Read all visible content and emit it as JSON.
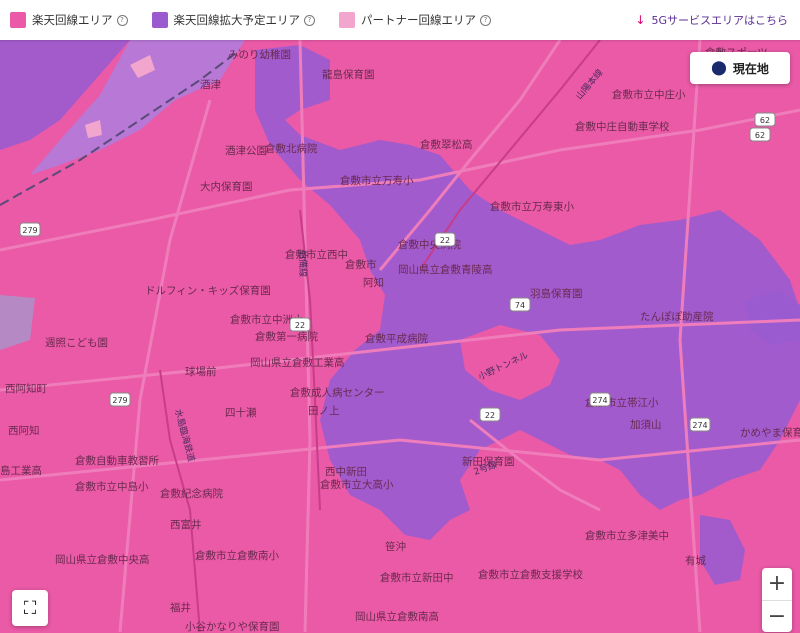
{
  "legend": {
    "items": [
      {
        "label": "楽天回線エリア",
        "color": "#ea5aa6"
      },
      {
        "label": "楽天回線拡大予定エリア",
        "color": "#9b5bd0"
      },
      {
        "label": "パートナー回線エリア",
        "color": "#f3a6cd"
      }
    ],
    "help_glyph": "?",
    "g5_link": "5Gサービスエリアはこちら"
  },
  "controls": {
    "current_location": "現在地",
    "zoom_in": "+",
    "zoom_out": "−",
    "fullscreen": "⛶"
  },
  "map": {
    "labels": [
      "みのり幼稚園",
      "龍島保育園",
      "倉敷スポーツ",
      "倉敷市立中庄小",
      "倉敷中庄自動車学校",
      "倉敷翠松高",
      "倉敷北病院",
      "酒津公園",
      "倉敷市立万寿小",
      "倉敷市立万寿東小",
      "大内保育園",
      "倉敷中央病院",
      "倉敷市立西中",
      "倉敷市",
      "岡山県立倉敷青陵高",
      "羽島保育園",
      "たんぽぽ助産院",
      "ドルフィン・キッズ保育園",
      "倉敷市立中洲小",
      "倉敷第一病院",
      "倉敷平成病院",
      "週照こども園",
      "岡山県立倉敷工業高",
      "倉敷成人病センター",
      "倉敷市立帯江小",
      "西阿知町",
      "西阿知",
      "四十瀬",
      "田ノ上",
      "かめやま保育",
      "倉敷自動車教習所",
      "新田保育園",
      "島工業高",
      "倉敷市立中島小",
      "倉敷紀念病院",
      "西中新田",
      "倉敷市立大高小",
      "西富井",
      "倉敷市立多津美中",
      "岡山県立倉敷中央高",
      "倉敷市立倉敷南小",
      "倉敷市立新田中",
      "倉敷市立倉敷支援学校",
      "福井",
      "小谷かなりや保育園",
      "岡山県立倉敷南高",
      "加須山",
      "笹沖",
      "有城",
      "阿知",
      "球場前",
      "酒津"
    ],
    "route_numbers": [
      "279",
      "279",
      "274",
      "22",
      "74",
      "22",
      "274",
      "62",
      "62",
      "22"
    ],
    "road_labels": [
      "山陽本線",
      "伯備線",
      "小野トンネル",
      "2号線",
      "水島臨海鉄道"
    ]
  }
}
